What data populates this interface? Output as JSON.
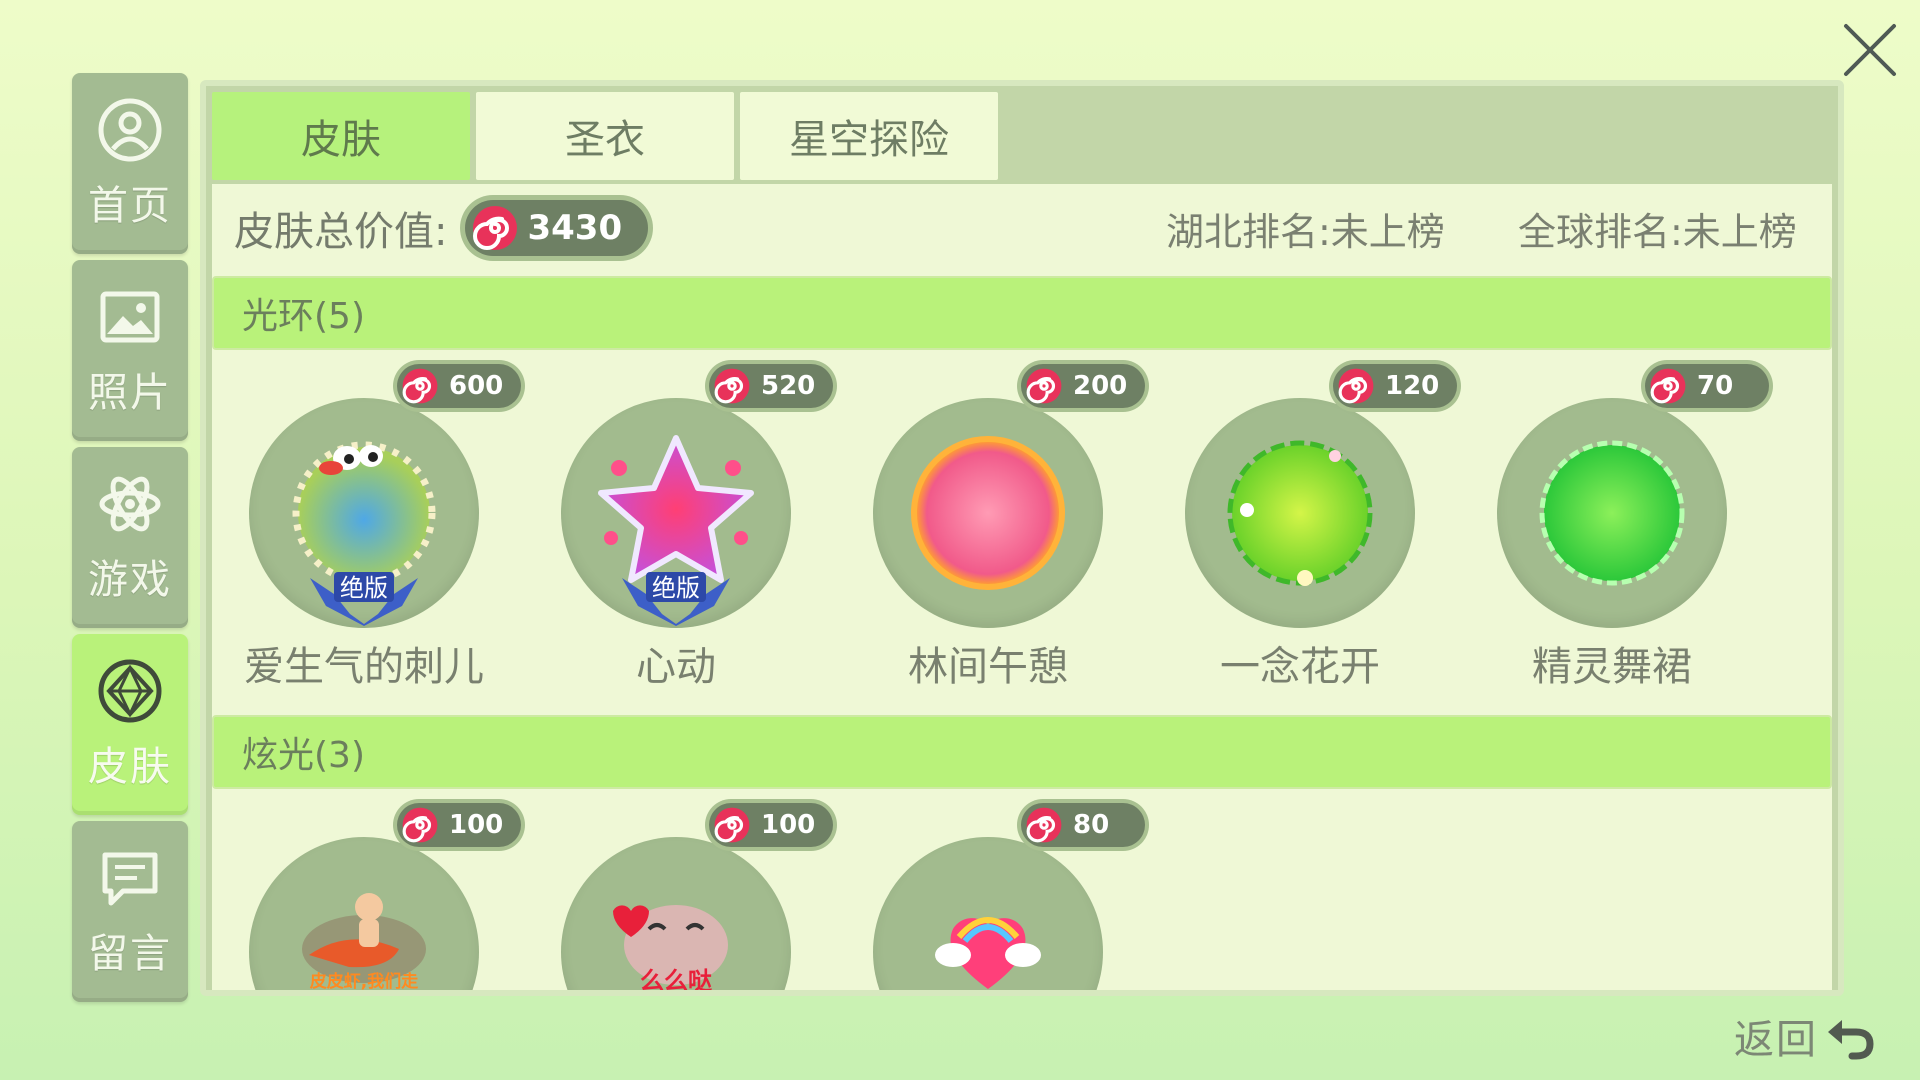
{
  "sidebar": {
    "items": [
      {
        "label": "首页",
        "icon": "user-icon"
      },
      {
        "label": "照片",
        "icon": "photo-icon"
      },
      {
        "label": "游戏",
        "icon": "atom-icon"
      },
      {
        "label": "皮肤",
        "icon": "diamond-icon",
        "active": true
      },
      {
        "label": "留言",
        "icon": "message-icon"
      }
    ]
  },
  "tabs": [
    {
      "label": "皮肤",
      "active": true
    },
    {
      "label": "圣衣"
    },
    {
      "label": "星空探险"
    }
  ],
  "summary": {
    "total_label": "皮肤总价值:",
    "total_value": "3430",
    "hubei_rank": "湖北排名:未上榜",
    "global_rank": "全球排名:未上榜"
  },
  "sections": [
    {
      "title": "光环(5)",
      "items": [
        {
          "name": "爱生气的刺儿",
          "price": "600",
          "badge": "绝版"
        },
        {
          "name": "心动",
          "price": "520",
          "badge": "绝版"
        },
        {
          "name": "林间午憩",
          "price": "200"
        },
        {
          "name": "一念花开",
          "price": "120"
        },
        {
          "name": "精灵舞裙",
          "price": "70"
        }
      ]
    },
    {
      "title": "炫光(3)",
      "items": [
        {
          "name": "",
          "price": "100",
          "art_text": "皮皮虾,我们走"
        },
        {
          "name": "",
          "price": "100",
          "art_text": "么么哒"
        },
        {
          "name": "",
          "price": "80"
        }
      ]
    }
  ],
  "back_label": "返回",
  "colors": {
    "accent_green": "#b9f27a",
    "coin_pink": "#e8325a",
    "pill_dark": "#6e8064"
  }
}
